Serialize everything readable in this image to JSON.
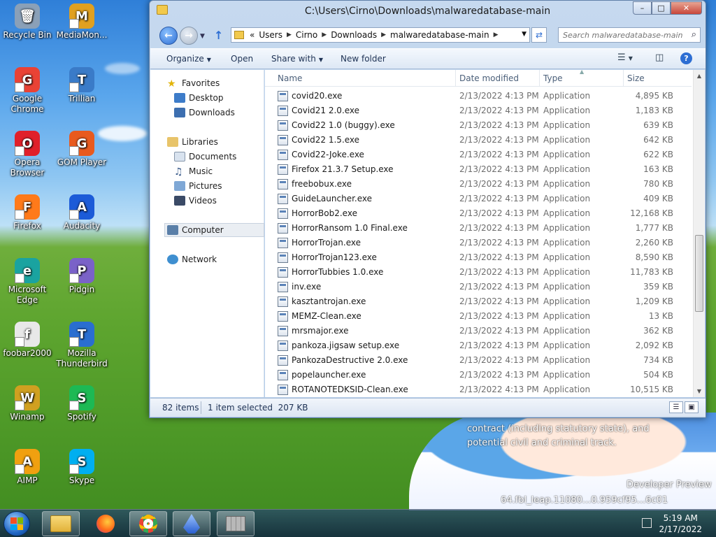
{
  "desktop": {
    "icons": [
      {
        "label": "Recycle Bin",
        "color": "#8aa0b8",
        "glyph": "🗑"
      },
      {
        "label": "MediaMon...",
        "color": "#e0a020",
        "glyph": "M"
      },
      {
        "label": "Google Chrome",
        "color": "#e94235",
        "glyph": "G"
      },
      {
        "label": "Trillian",
        "color": "#3a7bc8",
        "glyph": "T"
      },
      {
        "label": "Opera Browser",
        "color": "#e0202a",
        "glyph": "O"
      },
      {
        "label": "GOM Player",
        "color": "#e85a1e",
        "glyph": "G"
      },
      {
        "label": "Firefox",
        "color": "#ff7a1a",
        "glyph": "F"
      },
      {
        "label": "Audacity",
        "color": "#1c5bd8",
        "glyph": "A"
      },
      {
        "label": "Microsoft Edge",
        "color": "#1aa3a0",
        "glyph": "e"
      },
      {
        "label": "Pidgin",
        "color": "#7a62c8",
        "glyph": "P"
      },
      {
        "label": "foobar2000",
        "color": "#e8e8e8",
        "glyph": "f"
      },
      {
        "label": "Mozilla Thunderbird",
        "color": "#2a6ed0",
        "glyph": "T"
      },
      {
        "label": "Winamp",
        "color": "#d0a020",
        "glyph": "W"
      },
      {
        "label": "Spotify",
        "color": "#1db954",
        "glyph": "S"
      },
      {
        "label": "AIMP",
        "color": "#f0a010",
        "glyph": "A"
      },
      {
        "label": "Skype",
        "color": "#00aff0",
        "glyph": "S"
      }
    ],
    "wallpaper_text": [
      "contract (including statutory state), and",
      "potential civil and criminal track.",
      "Developer Preview",
      "64.fbl_leap.11080...0.959cf95...6c01"
    ]
  },
  "window": {
    "title": "C:\\Users\\Cirno\\Downloads\\malwaredatabase-main",
    "address": {
      "prefix": "«",
      "segments": [
        "Users",
        "Cirno",
        "Downloads",
        "malwaredatabase-main"
      ]
    },
    "search_placeholder": "Search malwaredatabase-main",
    "toolbar": {
      "organize": "Organize",
      "open": "Open",
      "share_with": "Share with",
      "new_folder": "New folder"
    },
    "nav": {
      "favorites": "Favorites",
      "desktop": "Desktop",
      "downloads": "Downloads",
      "libraries": "Libraries",
      "documents": "Documents",
      "music": "Music",
      "pictures": "Pictures",
      "videos": "Videos",
      "computer": "Computer",
      "network": "Network"
    },
    "columns": {
      "name": "Name",
      "date": "Date modified",
      "type": "Type",
      "size": "Size"
    },
    "files": [
      {
        "name": "covid20.exe",
        "date": "2/13/2022 4:13 PM",
        "type": "Application",
        "size": "4,895 KB"
      },
      {
        "name": "Covid21 2.0.exe",
        "date": "2/13/2022 4:13 PM",
        "type": "Application",
        "size": "1,183 KB"
      },
      {
        "name": "Covid22 1.0 (buggy).exe",
        "date": "2/13/2022 4:13 PM",
        "type": "Application",
        "size": "639 KB"
      },
      {
        "name": "Covid22 1.5.exe",
        "date": "2/13/2022 4:13 PM",
        "type": "Application",
        "size": "642 KB"
      },
      {
        "name": "Covid22-Joke.exe",
        "date": "2/13/2022 4:13 PM",
        "type": "Application",
        "size": "622 KB"
      },
      {
        "name": "Firefox 21.3.7 Setup.exe",
        "date": "2/13/2022 4:13 PM",
        "type": "Application",
        "size": "163 KB"
      },
      {
        "name": "freebobux.exe",
        "date": "2/13/2022 4:13 PM",
        "type": "Application",
        "size": "780 KB"
      },
      {
        "name": "GuideLauncher.exe",
        "date": "2/13/2022 4:13 PM",
        "type": "Application",
        "size": "409 KB"
      },
      {
        "name": "HorrorBob2.exe",
        "date": "2/13/2022 4:13 PM",
        "type": "Application",
        "size": "12,168 KB"
      },
      {
        "name": "HorrorRansom 1.0 Final.exe",
        "date": "2/13/2022 4:13 PM",
        "type": "Application",
        "size": "1,777 KB"
      },
      {
        "name": "HorrorTrojan.exe",
        "date": "2/13/2022 4:13 PM",
        "type": "Application",
        "size": "2,260 KB"
      },
      {
        "name": "HorrorTrojan123.exe",
        "date": "2/13/2022 4:13 PM",
        "type": "Application",
        "size": "8,590 KB"
      },
      {
        "name": "HorrorTubbies 1.0.exe",
        "date": "2/13/2022 4:13 PM",
        "type": "Application",
        "size": "11,783 KB"
      },
      {
        "name": "inv.exe",
        "date": "2/13/2022 4:13 PM",
        "type": "Application",
        "size": "359 KB"
      },
      {
        "name": "kasztantrojan.exe",
        "date": "2/13/2022 4:13 PM",
        "type": "Application",
        "size": "1,209 KB"
      },
      {
        "name": "MEMZ-Clean.exe",
        "date": "2/13/2022 4:13 PM",
        "type": "Application",
        "size": "13 KB"
      },
      {
        "name": "mrsmajor.exe",
        "date": "2/13/2022 4:13 PM",
        "type": "Application",
        "size": "362 KB"
      },
      {
        "name": "pankoza.jigsaw setup.exe",
        "date": "2/13/2022 4:13 PM",
        "type": "Application",
        "size": "2,092 KB"
      },
      {
        "name": "PankozaDestructive 2.0.exe",
        "date": "2/13/2022 4:13 PM",
        "type": "Application",
        "size": "734 KB"
      },
      {
        "name": "popelauncher.exe",
        "date": "2/13/2022 4:13 PM",
        "type": "Application",
        "size": "504 KB"
      },
      {
        "name": "ROTANOTEDKSID-Clean.exe",
        "date": "2/13/2022 4:13 PM",
        "type": "Application",
        "size": "10,515 KB"
      }
    ],
    "status": {
      "items": "82 items",
      "selected": "1 item selected  207 KB"
    }
  },
  "taskbar": {
    "time": "5:19 AM",
    "date": "2/17/2022"
  },
  "colors": {
    "accent": "#2d6ed3",
    "window_frame": "#c6d9ef"
  }
}
